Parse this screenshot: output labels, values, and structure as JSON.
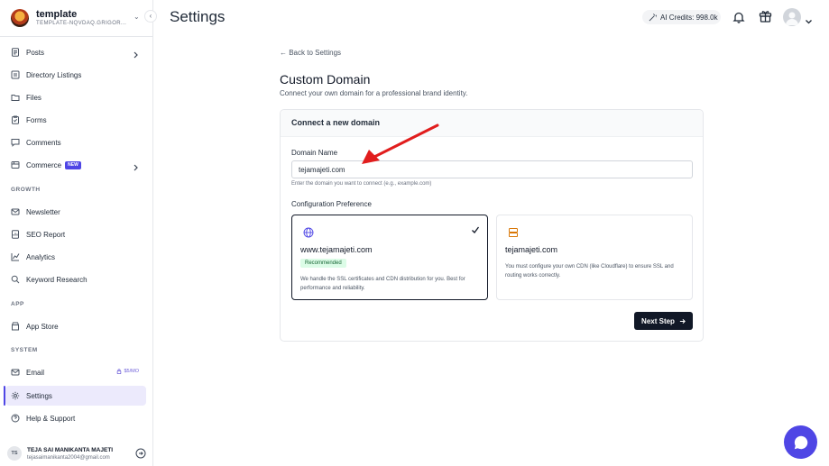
{
  "workspace": {
    "name": "template",
    "subtitle": "TEMPLATE-NQVDAQ.GRIGOR..."
  },
  "sidebar": {
    "items_main": [
      {
        "label": "Posts"
      },
      {
        "label": "Directory Listings"
      },
      {
        "label": "Files"
      },
      {
        "label": "Forms"
      },
      {
        "label": "Comments"
      },
      {
        "label": "Commerce",
        "badge": "NEW"
      }
    ],
    "sections": {
      "growth": "GROWTH",
      "app": "APP",
      "system": "SYSTEM"
    },
    "items_growth": [
      {
        "label": "Newsletter"
      },
      {
        "label": "SEO Report"
      },
      {
        "label": "Analytics"
      },
      {
        "label": "Keyword Research"
      }
    ],
    "items_app": [
      {
        "label": "App Store"
      }
    ],
    "items_system": [
      {
        "label": "Email",
        "badge": "$5/MO"
      },
      {
        "label": "Settings"
      },
      {
        "label": "Help & Support"
      }
    ],
    "user": {
      "initials": "TS",
      "name": "TEJA SAI MANIKANTA MAJETI",
      "email": "tejasaimanikanta2004@gmail.com"
    }
  },
  "header": {
    "title": "Settings",
    "credits": "AI Credits: 998.0k"
  },
  "main": {
    "back_link": "← Back to Settings",
    "title": "Custom Domain",
    "subtitle": "Connect your own domain for a professional brand identity.",
    "card": {
      "title": "Connect a new domain",
      "domain_label": "Domain Name",
      "domain_value": "tejamajeti.com",
      "domain_helper": "Enter the domain you want to connect (e.g., example.com)",
      "config_label": "Configuration Preference",
      "options": [
        {
          "title": "www.tejamajeti.com",
          "badge": "Recommended",
          "description": "We handle the SSL certificates and CDN distribution for you. Best for performance and reliability.",
          "selected": true
        },
        {
          "title": "tejamajeti.com",
          "description": "You must configure your own CDN (like Cloudflare) to ensure SSL and routing works correctly.",
          "selected": false
        }
      ],
      "next_button": "Next Step"
    }
  },
  "colors": {
    "accent": "#4f46e5",
    "annotation": "#e11d1d",
    "selected_border": "#111827",
    "badge_bg": "#dcfce7"
  }
}
